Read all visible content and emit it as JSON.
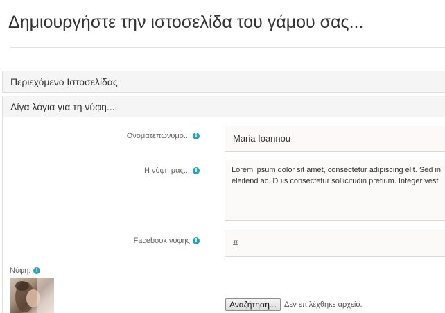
{
  "page": {
    "title": "Δημιουργήστε την ιστοσελίδα του γάμου σας..."
  },
  "panels": [
    {
      "label": "Περιεχόμενο Ιστοσελίδας"
    },
    {
      "label": "Λίγα λόγια για τη νύφη..."
    }
  ],
  "form": {
    "fields": [
      {
        "label": "Ονοματεπώνυμο...",
        "value": "Maria Ioannou"
      },
      {
        "label": "Η νύφη μας...",
        "value_lines": [
          "Lorem ipsum dolor sit amet, consectetur adipiscing elit. Sed in",
          "eleifend ac. Duis consectetur sollicitudin pretium. Integer vest"
        ]
      },
      {
        "label": "Facebook νύφης",
        "value": "#"
      }
    ],
    "bride_photo_label": "Νύφη:",
    "info_glyph": "i",
    "upload": {
      "button_label": "Αναζήτηση...",
      "status_text": "Δεν επιλέχθηκε αρχείο."
    }
  },
  "colors": {
    "info_icon": "#27a3b3",
    "panel_header_bg": "#f5f5f5",
    "input_bg": "#fbfaf8"
  }
}
